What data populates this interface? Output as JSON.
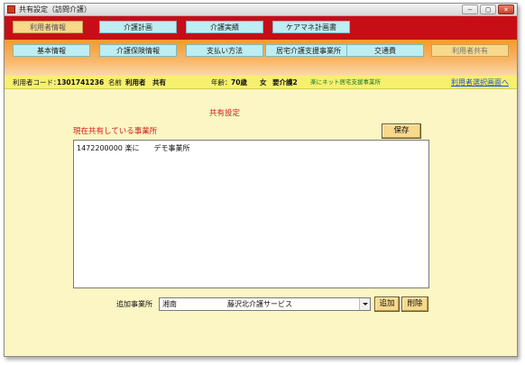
{
  "window": {
    "title": "共有設定（訪問介護）"
  },
  "top_tabs": [
    {
      "label": "利用者情報",
      "active": true
    },
    {
      "label": "介護計画",
      "active": false
    },
    {
      "label": "介護実績",
      "active": false
    },
    {
      "label": "ケアマネ計画書",
      "active": false
    }
  ],
  "sub_tabs": [
    {
      "label": "基本情報",
      "active": false
    },
    {
      "label": "介護保険情報",
      "active": false
    },
    {
      "label": "支払い方法",
      "active": false
    },
    {
      "label": "居宅介護支援事業所",
      "active": false
    },
    {
      "label": "交通費",
      "active": false
    },
    {
      "label": "利用者共有",
      "active": true
    }
  ],
  "user_bar": {
    "code_label": "利用者コード：",
    "code_value": "1301741236",
    "name_label": "名前",
    "name_value": "利用者　共有",
    "age_label": "年齢：",
    "age_value": "70歳",
    "gender": "女",
    "care_level": "要介護2",
    "office": "楽にネット居宅支援事業所",
    "select_link": "利用者選択画面へ"
  },
  "section_title": "共有設定",
  "shared_list": {
    "label": "現在共有している事業所",
    "items": [
      "1472200000 楽に　　デモ事業所"
    ]
  },
  "save_button": "保存",
  "add_office": {
    "label": "追加事業所",
    "selected": "湘南　　　　　　　藤沢北介護サービス"
  },
  "add_button": "追加",
  "delete_button": "削除",
  "colors": {
    "title_red": "#c70e17",
    "nav_cyan": "#bdeef3",
    "active_tab": "#f7d98c",
    "subnav_orange": "#f79a2a",
    "user_bar_yellow": "#f7f06e",
    "body_cream": "#fbf6c4",
    "heading_red": "#d21a1a",
    "link_blue": "#1a4fd6"
  }
}
